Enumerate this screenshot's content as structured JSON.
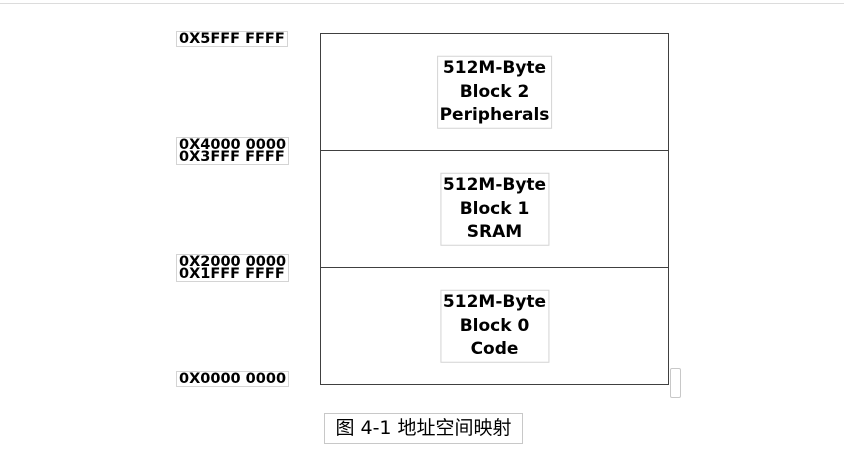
{
  "addresses": {
    "top": "0X5FFF FFFF",
    "boundary_2_lower": "0X4000 0000",
    "boundary_2_upper": "0X3FFF FFFF",
    "boundary_1_lower": "0X2000 0000",
    "boundary_1_upper": "0X1FFF FFFF",
    "bottom": "0X0000 0000"
  },
  "blocks": [
    {
      "size": "512M-Byte",
      "name": "Block 2",
      "region": "Peripherals"
    },
    {
      "size": "512M-Byte",
      "name": "Block 1",
      "region": "SRAM"
    },
    {
      "size": "512M-Byte",
      "name": "Block 0",
      "region": "Code"
    }
  ],
  "caption": "图 4-1 地址空间映射"
}
